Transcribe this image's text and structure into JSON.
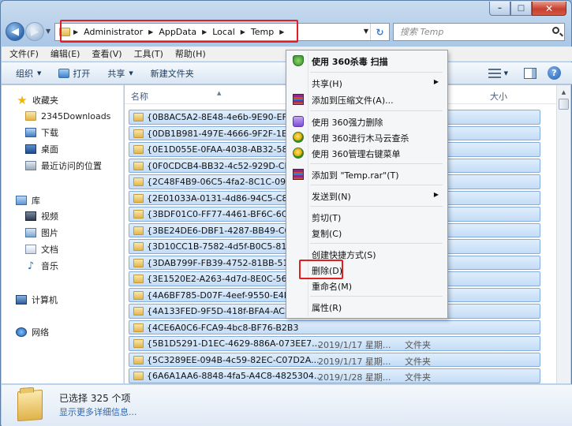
{
  "window": {
    "min_label": "–",
    "max_label": "□",
    "close_label": "✕"
  },
  "address": {
    "crumbs": [
      "Administrator",
      "AppData",
      "Local",
      "Temp"
    ],
    "search_placeholder": "搜索 Temp"
  },
  "menubar": [
    "文件(F)",
    "编辑(E)",
    "查看(V)",
    "工具(T)",
    "帮助(H)"
  ],
  "toolbar": {
    "organize": "组织",
    "open": "打开",
    "share": "共享",
    "new_folder": "新建文件夹"
  },
  "navpane": {
    "favorites": "收藏夹",
    "downloads_2345": "2345Downloads",
    "downloads": "下载",
    "desktop": "桌面",
    "recent": "最近访问的位置",
    "libraries": "库",
    "videos": "视频",
    "pictures": "图片",
    "documents": "文档",
    "music": "音乐",
    "computer": "计算机",
    "network": "网络"
  },
  "columns": {
    "name": "名称",
    "size": "大小"
  },
  "files": [
    {
      "name": "{0B8AC5A2-8E48-4e6b-9E90-EF69",
      "date": "",
      "type": ""
    },
    {
      "name": "{0DB1B981-497E-4666-9F2F-1E8B",
      "date": "",
      "type": ""
    },
    {
      "name": "{0E1D055E-0FAA-4038-AB32-58BF",
      "date": "",
      "type": ""
    },
    {
      "name": "{0F0CDCB4-BB32-4c52-929D-CB0",
      "date": "",
      "type": ""
    },
    {
      "name": "{2C48F4B9-06C5-4fa2-8C1C-099C",
      "date": "",
      "type": ""
    },
    {
      "name": "{2E01033A-0131-4d86-94C5-C8DC",
      "date": "",
      "type": ""
    },
    {
      "name": "{3BDF01C0-FF77-4461-BF6C-6C87",
      "date": "",
      "type": ""
    },
    {
      "name": "{3BE24DE6-DBF1-4287-BB49-C09C",
      "date": "",
      "type": ""
    },
    {
      "name": "{3D10CC1B-7582-4d5f-B0C5-81EF",
      "date": "",
      "type": ""
    },
    {
      "name": "{3DAB799F-FB39-4752-81BB-516D",
      "date": "",
      "type": ""
    },
    {
      "name": "{3E1520E2-A263-4d7d-8E0C-5636",
      "date": "",
      "type": ""
    },
    {
      "name": "{4A6BF785-D07F-4eef-9550-E4D97",
      "date": "",
      "type": ""
    },
    {
      "name": "{4A133FED-9F5D-418f-BFA4-AC20",
      "date": "",
      "type": ""
    },
    {
      "name": "{4CE6A0C6-FCA9-4bc8-BF76-B2B3",
      "date": "",
      "type": ""
    },
    {
      "name": "{5B1D5291-D1EC-4629-886A-073EE7...",
      "date": "2019/1/17 星期...",
      "type": "文件夹"
    },
    {
      "name": "{5C3289EE-094B-4c59-82EC-C07D2A...",
      "date": "2019/1/17 星期...",
      "type": "文件夹"
    },
    {
      "name": "{6A6A1AA6-8848-4fa5-A4C8-4825304...",
      "date": "2019/1/28 星期...",
      "type": "文件夹"
    },
    {
      "name": "{6D1E1233-2556-4713-8622-2A6D77...",
      "date": "2019/1/17 星期...",
      "type": "文件夹"
    }
  ],
  "details": {
    "selected": "已选择 325 个项",
    "more": "显示更多详细信息..."
  },
  "context_menu": {
    "scan_360": "使用 360杀毒 扫描",
    "share": "共享(H)",
    "add_archive": "添加到压缩文件(A)...",
    "force_delete_360": "使用 360强力删除",
    "cloud_scan_360": "使用 360进行木马云查杀",
    "manage_menu_360": "使用 360管理右键菜单",
    "add_rar": "添加到 \"Temp.rar\"(T)",
    "send_to": "发送到(N)",
    "cut": "剪切(T)",
    "copy": "复制(C)",
    "create_shortcut": "创建快捷方式(S)",
    "delete": "删除(D)",
    "rename": "重命名(M)",
    "properties": "属性(R)"
  }
}
